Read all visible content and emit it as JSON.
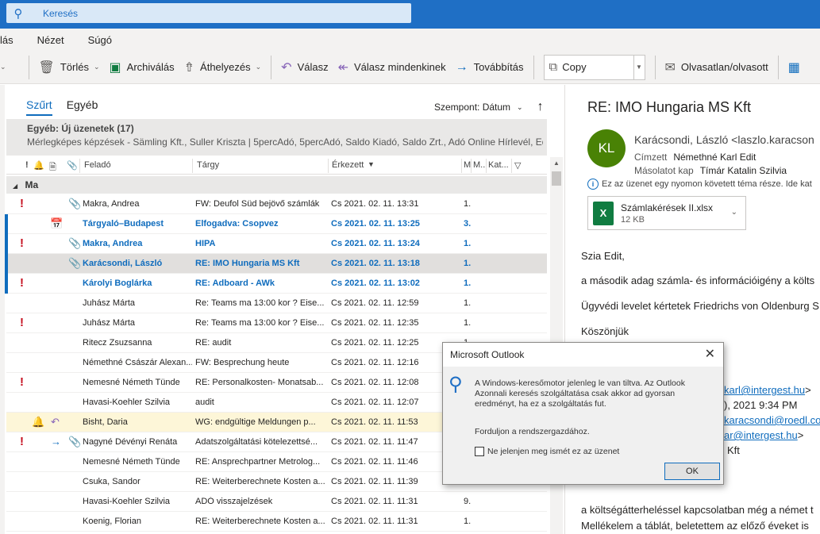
{
  "search": {
    "placeholder": "Keresés"
  },
  "menu": [
    "lás",
    "Nézet",
    "Súgó"
  ],
  "ribbon": {
    "delete": "Törlés",
    "archive": "Archiválás",
    "move": "Áthelyezés",
    "reply": "Válasz",
    "reply_all": "Válasz mindenkinek",
    "forward": "Továbbítás",
    "copy": "Copy",
    "read_unread": "Olvasatlan/olvasott"
  },
  "tabs": {
    "focused": "Szűrt",
    "other": "Egyéb"
  },
  "sort": {
    "label": "Szempont: Dátum"
  },
  "other_box": {
    "title": "Egyéb: Új üzenetek (17)",
    "senders": "Mérlegképes képzések - Sämling Kft., Suller Kriszta | 5percAdó, 5percAdó, Saldo Kiadó, Saldo Zrt., Adó Online Hírlevél, Ed..."
  },
  "columns": {
    "importance": "!",
    "from": "Feladó",
    "subject": "Tárgy",
    "received": "Érkezett",
    "m": "M",
    "m2": "M..",
    "cat": "Kat..."
  },
  "group": "Ma",
  "messages": [
    {
      "from": "Makra, Andrea",
      "subject": "FW: Deufol Süd bejövő számlák",
      "received": "Cs 2021. 02. 11.  13:31",
      "m": "1.",
      "flag": true,
      "attach": true,
      "unread": false
    },
    {
      "from": "Tárgyaló–Budapest",
      "subject": "Elfogadva: Csopvez",
      "received": "Cs 2021. 02. 11.  13:25",
      "m": "3.",
      "flag": false,
      "attach": false,
      "unread": true,
      "calendar": true
    },
    {
      "from": "Makra, Andrea",
      "subject": "HIPA",
      "received": "Cs 2021. 02. 11.  13:24",
      "m": "1.",
      "flag": true,
      "attach": true,
      "unread": true
    },
    {
      "from": "Karácsondi, László",
      "subject": "RE: IMO Hungaria MS Kft",
      "received": "Cs 2021. 02. 11.  13:18",
      "m": "1.",
      "flag": false,
      "attach": true,
      "unread": true,
      "selected": true
    },
    {
      "from": "Károlyi Boglárka",
      "subject": "RE: Adboard - AWk",
      "received": "Cs 2021. 02. 11.  13:02",
      "m": "1.",
      "flag": true,
      "attach": false,
      "unread": true
    },
    {
      "from": "Juhász Márta",
      "subject": "Re: Teams ma  13:00 kor ? Eise...",
      "received": "Cs 2021. 02. 11.  12:59",
      "m": "1.",
      "flag": false,
      "attach": false,
      "unread": false
    },
    {
      "from": "Juhász Márta",
      "subject": "Re: Teams ma  13:00 kor ? Eise...",
      "received": "Cs 2021. 02. 11.  12:35",
      "m": "1.",
      "flag": true,
      "attach": false,
      "unread": false
    },
    {
      "from": "Ritecz Zsuzsanna",
      "subject": "RE: audit",
      "received": "Cs 2021. 02. 11.  12:25",
      "m": "1.",
      "flag": false,
      "attach": false,
      "unread": false
    },
    {
      "from": "Némethné Császár Alexan...",
      "subject": "FW: Besprechung heute",
      "received": "Cs 2021. 02. 11.  12:16",
      "m": "",
      "flag": false,
      "attach": false,
      "unread": false
    },
    {
      "from": "Nemesné Németh Tünde",
      "subject": "RE: Personalkosten- Monatsab...",
      "received": "Cs 2021. 02. 11.  12:08",
      "m": "",
      "flag": true,
      "attach": false,
      "unread": false
    },
    {
      "from": "Havasi-Koehler Szilvia",
      "subject": "audit",
      "received": "Cs 2021. 02. 11.  12:07",
      "m": "",
      "flag": false,
      "attach": false,
      "unread": false
    },
    {
      "from": "Bisht, Daria",
      "subject": "WG: endgültige Meldungen p...",
      "received": "Cs 2021. 02. 11.  11:53",
      "m": "",
      "flag": false,
      "attach": false,
      "unread": false,
      "bell": true,
      "replied": true,
      "highlight": true
    },
    {
      "from": "Nagyné Dévényi Renáta",
      "subject": "Adatszolgáltatási kötelezettsé...",
      "received": "Cs 2021. 02. 11.  11:47",
      "m": "",
      "flag": true,
      "attach": true,
      "unread": false,
      "forwarded": true
    },
    {
      "from": "Nemesné Németh Tünde",
      "subject": "RE: Ansprechpartner Metrolog...",
      "received": "Cs 2021. 02. 11.  11:46",
      "m": "",
      "flag": false,
      "attach": false,
      "unread": false
    },
    {
      "from": "Csuka, Sandor",
      "subject": "RE: Weiterberechnete Kosten a...",
      "received": "Cs 2021. 02. 11.  11:39",
      "m": "",
      "flag": false,
      "attach": false,
      "unread": false
    },
    {
      "from": "Havasi-Koehler Szilvia",
      "subject": "ADÓ visszajelzések",
      "received": "Cs 2021. 02. 11.  11:31",
      "m": "9.",
      "flag": false,
      "attach": false,
      "unread": false
    },
    {
      "from": "Koenig, Florian",
      "subject": "RE: Weiterberechnete Kosten a...",
      "received": "Cs 2021. 02. 11.  11:31",
      "m": "1.",
      "flag": false,
      "attach": false,
      "unread": false
    }
  ],
  "reading": {
    "subject": "RE: IMO Hungaria MS Kft",
    "avatar_initials": "KL",
    "avatar_color": "#498205",
    "sender": "Karácsondi, László <laszlo.karacson",
    "to_label": "Címzett",
    "to": "Némethné Karl Edit",
    "cc_label": "Másolatot kap",
    "cc": "Tímár Katalin Szilvia",
    "info": "Ez az üzenet egy nyomon követett téma része. Ide kat",
    "attachment": {
      "name": "Számlakérések II.xlsx",
      "size": "12 KB",
      "type_letter": "X"
    },
    "body": [
      "Szia Edit,",
      "a második adag számla- és információigény a költs",
      "Ügyvédi levelet kértetek Friedrichs von Oldenburg S",
      "Köszönjük"
    ],
    "quoted": {
      "line1": "karl@intergest.hu",
      "line1_suffix": ">",
      "line2": "), 2021 9:34 PM",
      "line3": "karacsondi@roedl.co",
      "line4": "ar@intergest.hu",
      "line4_suffix": ">",
      "line5": "Kft"
    },
    "body2": [
      "a költségátterheléssel kapcsolatban még a német t",
      "Mellékelem a táblát, beletettem az előző éveket is"
    ]
  },
  "dialog": {
    "title": "Microsoft Outlook",
    "message": "A Windows-keresőmotor jelenleg le van tiltva. Az Outlook Azonnali keresés szolgáltatása csak akkor ad gyorsan eredményt, ha ez a szolgáltatás fut.",
    "message2": "Forduljon a rendszergazdához.",
    "checkbox": "Ne jelenjen meg ismét ez az üzenet",
    "ok": "OK"
  }
}
